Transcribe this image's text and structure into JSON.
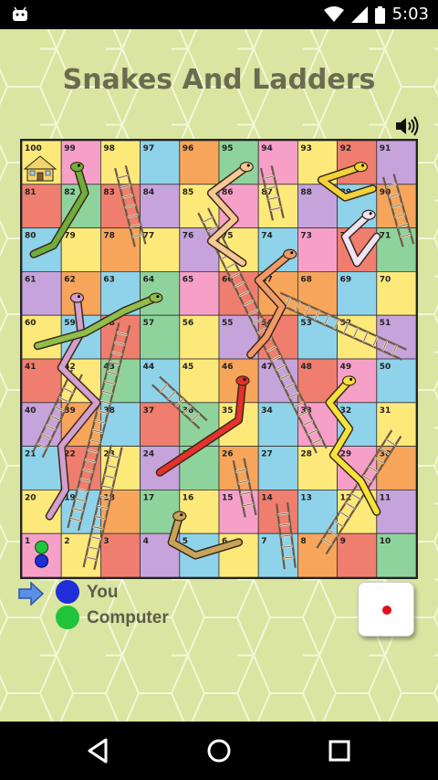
{
  "status_bar": {
    "time": "5:03"
  },
  "app": {
    "title": "Snakes And Ladders"
  },
  "board": {
    "rows": [
      [
        100,
        99,
        98,
        97,
        96,
        95,
        94,
        93,
        92,
        91
      ],
      [
        81,
        82,
        83,
        84,
        85,
        86,
        87,
        88,
        89,
        90
      ],
      [
        80,
        79,
        78,
        77,
        76,
        75,
        74,
        73,
        72,
        71
      ],
      [
        61,
        62,
        63,
        64,
        65,
        66,
        67,
        68,
        69,
        70
      ],
      [
        60,
        59,
        58,
        57,
        56,
        55,
        54,
        53,
        52,
        51
      ],
      [
        41,
        42,
        43,
        44,
        45,
        46,
        47,
        48,
        49,
        50
      ],
      [
        40,
        39,
        38,
        37,
        36,
        35,
        34,
        33,
        32,
        31
      ],
      [
        21,
        22,
        23,
        24,
        25,
        26,
        27,
        28,
        29,
        30
      ],
      [
        20,
        19,
        18,
        17,
        16,
        15,
        14,
        13,
        12,
        11
      ],
      [
        1,
        2,
        3,
        4,
        5,
        6,
        7,
        8,
        9,
        10
      ]
    ],
    "colors": [
      [
        "#fde97a",
        "#f6a0c8",
        "#fde97a",
        "#8fd3ea",
        "#f7a55b",
        "#8fd39c",
        "#f6a0c8",
        "#fde97a",
        "#f07e6e",
        "#c7a3dc"
      ],
      [
        "#f07e6e",
        "#8fd39c",
        "#f07e6e",
        "#c7a3dc",
        "#fde97a",
        "#f6a0c8",
        "#fde97a",
        "#c7a3dc",
        "#8fd3ea",
        "#f7a55b"
      ],
      [
        "#8fd3ea",
        "#fde97a",
        "#f7a55b",
        "#fde97a",
        "#c7a3dc",
        "#fde97a",
        "#8fd3ea",
        "#f6a0c8",
        "#f07e6e",
        "#8fd39c"
      ],
      [
        "#c7a3dc",
        "#f7a55b",
        "#8fd3ea",
        "#8fd39c",
        "#f6a0c8",
        "#f07e6e",
        "#f7a55b",
        "#f7a55b",
        "#8fd3ea",
        "#fde97a"
      ],
      [
        "#fde97a",
        "#8fd3ea",
        "#f07e6e",
        "#8fd39c",
        "#fde97a",
        "#c7a3dc",
        "#f07e6e",
        "#8fd3ea",
        "#fde97a",
        "#c7a3dc"
      ],
      [
        "#f07e6e",
        "#fde97a",
        "#8fd39c",
        "#8fd3ea",
        "#fde97a",
        "#f7a55b",
        "#c7a3dc",
        "#f07e6e",
        "#f6a0c8",
        "#8fd3ea"
      ],
      [
        "#c7a3dc",
        "#f7a55b",
        "#8fd3ea",
        "#f07e6e",
        "#8fd39c",
        "#fde97a",
        "#8fd3ea",
        "#f6a0c8",
        "#8fd3ea",
        "#fde97a"
      ],
      [
        "#8fd3ea",
        "#f07e6e",
        "#fde97a",
        "#c7a3dc",
        "#8fd39c",
        "#f7a55b",
        "#8fd3ea",
        "#fde97a",
        "#f6a0c8",
        "#f7a55b"
      ],
      [
        "#fde97a",
        "#8fd3ea",
        "#f7a55b",
        "#8fd39c",
        "#fde97a",
        "#f6a0c8",
        "#f07e6e",
        "#8fd3ea",
        "#fde97a",
        "#c7a3dc"
      ],
      [
        "#f6a0c8",
        "#fde97a",
        "#f07e6e",
        "#c7a3dc",
        "#8fd3ea",
        "#fde97a",
        "#8fd3ea",
        "#f7a55b",
        "#f07e6e",
        "#8fd39c"
      ]
    ]
  },
  "players": {
    "you": {
      "label": "You",
      "color": "#1f2ed6"
    },
    "computer": {
      "label": "Computer",
      "color": "#22c23a"
    }
  },
  "dice": {
    "value": 1
  }
}
